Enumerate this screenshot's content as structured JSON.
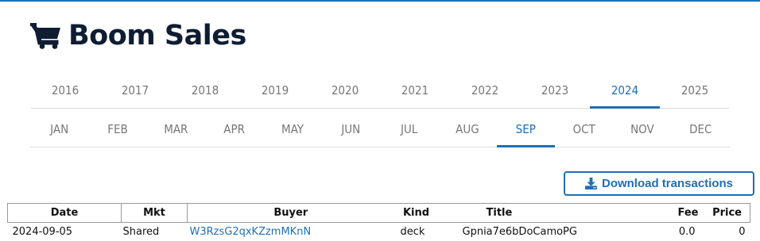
{
  "header": {
    "title": "Boom Sales",
    "icon": "shopping-cart-icon",
    "accent_color": "#1f6fb5",
    "title_color": "#0f1d33"
  },
  "years": {
    "items": [
      "2016",
      "2017",
      "2018",
      "2019",
      "2020",
      "2021",
      "2022",
      "2023",
      "2024",
      "2025"
    ],
    "selected": "2024"
  },
  "months": {
    "items": [
      "JAN",
      "FEB",
      "MAR",
      "APR",
      "MAY",
      "JUN",
      "JUL",
      "AUG",
      "SEP",
      "OCT",
      "NOV",
      "DEC"
    ],
    "selected": "SEP"
  },
  "download": {
    "label": "Download transactions",
    "icon": "download-icon"
  },
  "table": {
    "columns": [
      "Date",
      "Mkt",
      "Buyer",
      "Kind",
      "Title",
      "Fee",
      "Price"
    ],
    "rows": [
      {
        "date": "2024-09-05",
        "mkt": "Shared",
        "buyer": "W3RzsG2qxKZzmMKnN",
        "kind": "deck",
        "title": "Gpnia7e6bDoCamoPG",
        "fee": "0.0",
        "price": "0"
      }
    ]
  }
}
